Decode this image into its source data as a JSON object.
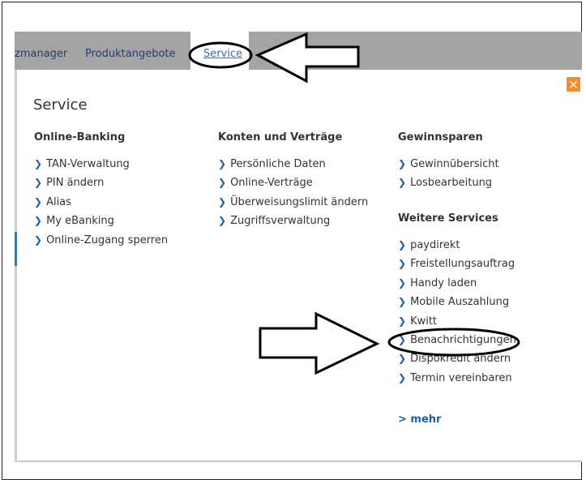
{
  "nav": {
    "items": [
      "zmanager",
      "Produktangebote"
    ],
    "active": "Service"
  },
  "panel": {
    "title": "Service",
    "close_glyph": "×",
    "more_label": "> mehr"
  },
  "columns": [
    {
      "heading": "Online-Banking",
      "items": [
        "TAN-Verwaltung",
        "PIN ändern",
        "Alias",
        "My eBanking",
        "Online-Zugang sperren"
      ]
    },
    {
      "heading": "Konten und Verträge",
      "items": [
        "Persönliche Daten",
        "Online-Verträge",
        "Überweisungslimit ändern",
        "Zugriffsverwaltung"
      ]
    },
    {
      "heading": "Gewinnsparen",
      "items": [
        "Gewinnübersicht",
        "Losbearbeitung"
      ]
    },
    {
      "heading": "Weitere Services",
      "items": [
        "paydirekt",
        "Freistellungsauftrag",
        "Handy laden",
        "Mobile Auszahlung",
        "Kwitt",
        "Benachrichtigungen",
        "Dispokredit ändern",
        "Termin vereinbaren"
      ]
    }
  ],
  "colors": {
    "accent": "#1c5fa8",
    "close": "#f28d2f",
    "navbar": "#a4a4a4"
  },
  "icons": {
    "chevron": "chevron-right-icon",
    "close": "close-icon"
  }
}
